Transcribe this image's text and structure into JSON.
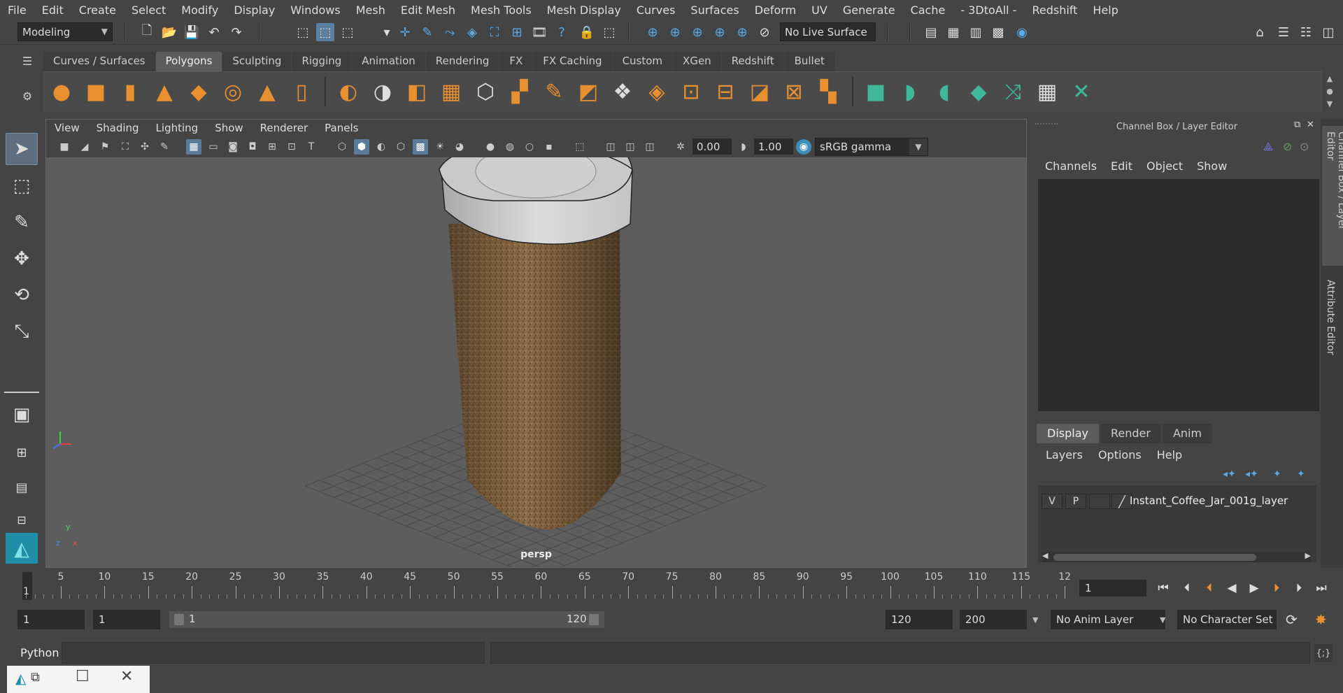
{
  "menubar": [
    "File",
    "Edit",
    "Create",
    "Select",
    "Modify",
    "Display",
    "Windows",
    "Mesh",
    "Edit Mesh",
    "Mesh Tools",
    "Mesh Display",
    "Curves",
    "Surfaces",
    "Deform",
    "UV",
    "Generate",
    "Cache",
    "- 3DtoAll -",
    "Redshift",
    "Help"
  ],
  "statusline": {
    "mode": "Modeling",
    "live_surface": "No Live Surface"
  },
  "shelf_tabs": [
    "Curves / Surfaces",
    "Polygons",
    "Sculpting",
    "Rigging",
    "Animation",
    "Rendering",
    "FX",
    "FX Caching",
    "Custom",
    "XGen",
    "Redshift",
    "Bullet"
  ],
  "active_shelf_tab": "Polygons",
  "viewport": {
    "menus": [
      "View",
      "Shading",
      "Lighting",
      "Show",
      "Renderer",
      "Panels"
    ],
    "exposure": "0.00",
    "gamma": "1.00",
    "color_space": "sRGB gamma",
    "camera_label": "persp",
    "axis": {
      "x": "x",
      "y": "y",
      "z": "z"
    }
  },
  "channel_box": {
    "title": "Channel Box / Layer Editor",
    "menus": [
      "Channels",
      "Edit",
      "Object",
      "Show"
    ]
  },
  "layer_editor": {
    "tabs": [
      "Display",
      "Render",
      "Anim"
    ],
    "menus": [
      "Layers",
      "Options",
      "Help"
    ],
    "layer": {
      "v": "V",
      "p": "P",
      "name": "Instant_Coffee_Jar_001g_layer"
    }
  },
  "side_tabs": [
    "Channel Box / Layer Editor",
    "Attribute Editor"
  ],
  "timeline": {
    "ticks": [
      "5",
      "10",
      "15",
      "20",
      "25",
      "30",
      "35",
      "40",
      "45",
      "50",
      "55",
      "60",
      "65",
      "70",
      "75",
      "80",
      "85",
      "90",
      "95",
      "100",
      "105",
      "110",
      "115",
      "12"
    ],
    "start_marker": "1",
    "current_frame": "1"
  },
  "range": {
    "start": "1",
    "playback_start": "1",
    "slider_start": "1",
    "slider_end": "120",
    "playback_end": "120",
    "end": "200",
    "anim_layer": "No Anim Layer",
    "character_set": "No Character Set"
  },
  "commandline": {
    "language": "Python"
  }
}
